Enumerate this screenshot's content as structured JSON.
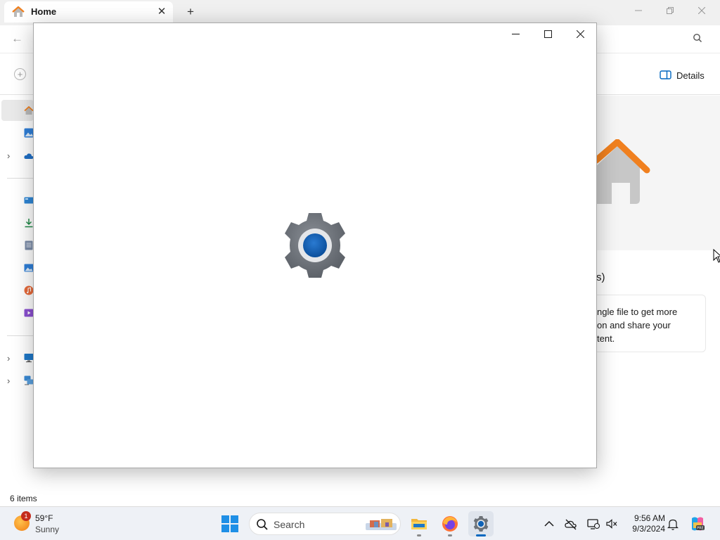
{
  "explorer": {
    "tab_title": "Home",
    "tab_close_glyph": "✕",
    "new_tab_glyph": "+",
    "window_controls": [
      "minimize",
      "maximize",
      "close"
    ],
    "back_glyph": "←",
    "details_label": "Details",
    "nav_items": [
      {
        "icon": "home-icon",
        "selected": true
      },
      {
        "icon": "gallery-icon"
      },
      {
        "icon": "onedrive-icon",
        "expandable": true
      },
      {
        "icon": "desktop-folder-icon"
      },
      {
        "icon": "downloads-icon"
      },
      {
        "icon": "documents-icon"
      },
      {
        "icon": "pictures-icon"
      },
      {
        "icon": "music-icon"
      },
      {
        "icon": "videos-icon"
      },
      {
        "icon": "this-pc-icon",
        "expandable": true
      },
      {
        "icon": "network-icon",
        "expandable": true
      }
    ],
    "partial_heading": "s)",
    "info_text": "ngle file to get more\non and share your\ntent.",
    "status_text": "6 items"
  },
  "settings_window": {
    "state": "loading",
    "splash_icon": "settings-gear-icon",
    "controls": {
      "minimize": "—",
      "maximize": "☐",
      "close": "✕"
    }
  },
  "taskbar": {
    "weather": {
      "temp": "59°F",
      "condition": "Sunny",
      "badge": "1"
    },
    "search_label": "Search",
    "apps": [
      {
        "name": "file-explorer",
        "active": false
      },
      {
        "name": "firefox",
        "active": false
      },
      {
        "name": "settings",
        "active": true
      }
    ],
    "tray_icons": [
      "chevron-up-icon",
      "onedrive-offline-icon",
      "network-icon",
      "volume-icon"
    ],
    "clock": {
      "time": "9:56 AM",
      "date": "9/3/2024"
    }
  },
  "colors": {
    "accent": "#0067c0",
    "gear_gray": "#6d7278",
    "gear_blue": "#0f62b6",
    "home_orange": "#f0801f"
  }
}
